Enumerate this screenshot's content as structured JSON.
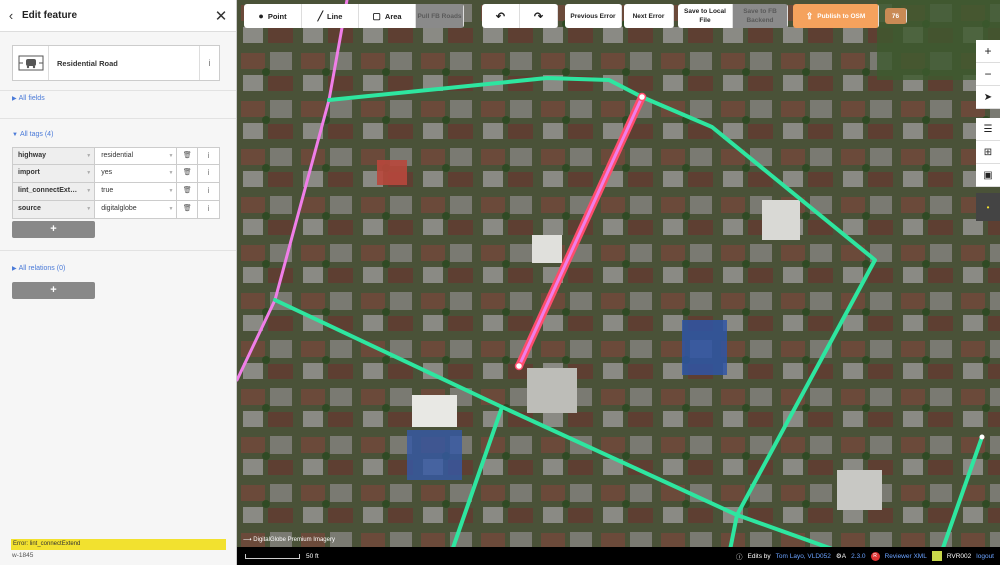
{
  "sidebar": {
    "title": "Edit feature",
    "preset_name": "Residential Road",
    "all_fields": "All fields",
    "all_tags": "All tags (4)",
    "tags": [
      {
        "key": "highway",
        "value": "residential"
      },
      {
        "key": "import",
        "value": "yes"
      },
      {
        "key": "lint_connectExt…",
        "value": "true"
      },
      {
        "key": "source",
        "value": "digitalglobe"
      }
    ],
    "add_label": "+",
    "all_relations": "All relations (0)",
    "error_text": "Error: lint_connectExtend",
    "way_id": "w-1845"
  },
  "toolbar": {
    "point": "Point",
    "line": "Line",
    "area": "Area",
    "pull_fb": "Pull FB Roads",
    "prev_error": "Previous Error",
    "next_error": "Next Error",
    "save_local": "Save to Local File",
    "save_fb": "Save to FB Backend",
    "publish": "Publish to OSM",
    "edit_count": "76"
  },
  "map": {
    "attribution": "DigitalGlobe Premium Imagery",
    "scale": "50 ft",
    "edits_by_prefix": "Edits by",
    "edits_by": "Tom Layo, VLD052",
    "version": "2.3.0",
    "reviewer": "Reviewer XML",
    "user": "RVR002",
    "logout": "logout"
  },
  "colors": {
    "road_green": "#2ee6a0",
    "road_pink": "#f07ee8",
    "selected": "#ff4d6d",
    "error_bar": "#f2e12f",
    "publish": "#f5a25d"
  }
}
